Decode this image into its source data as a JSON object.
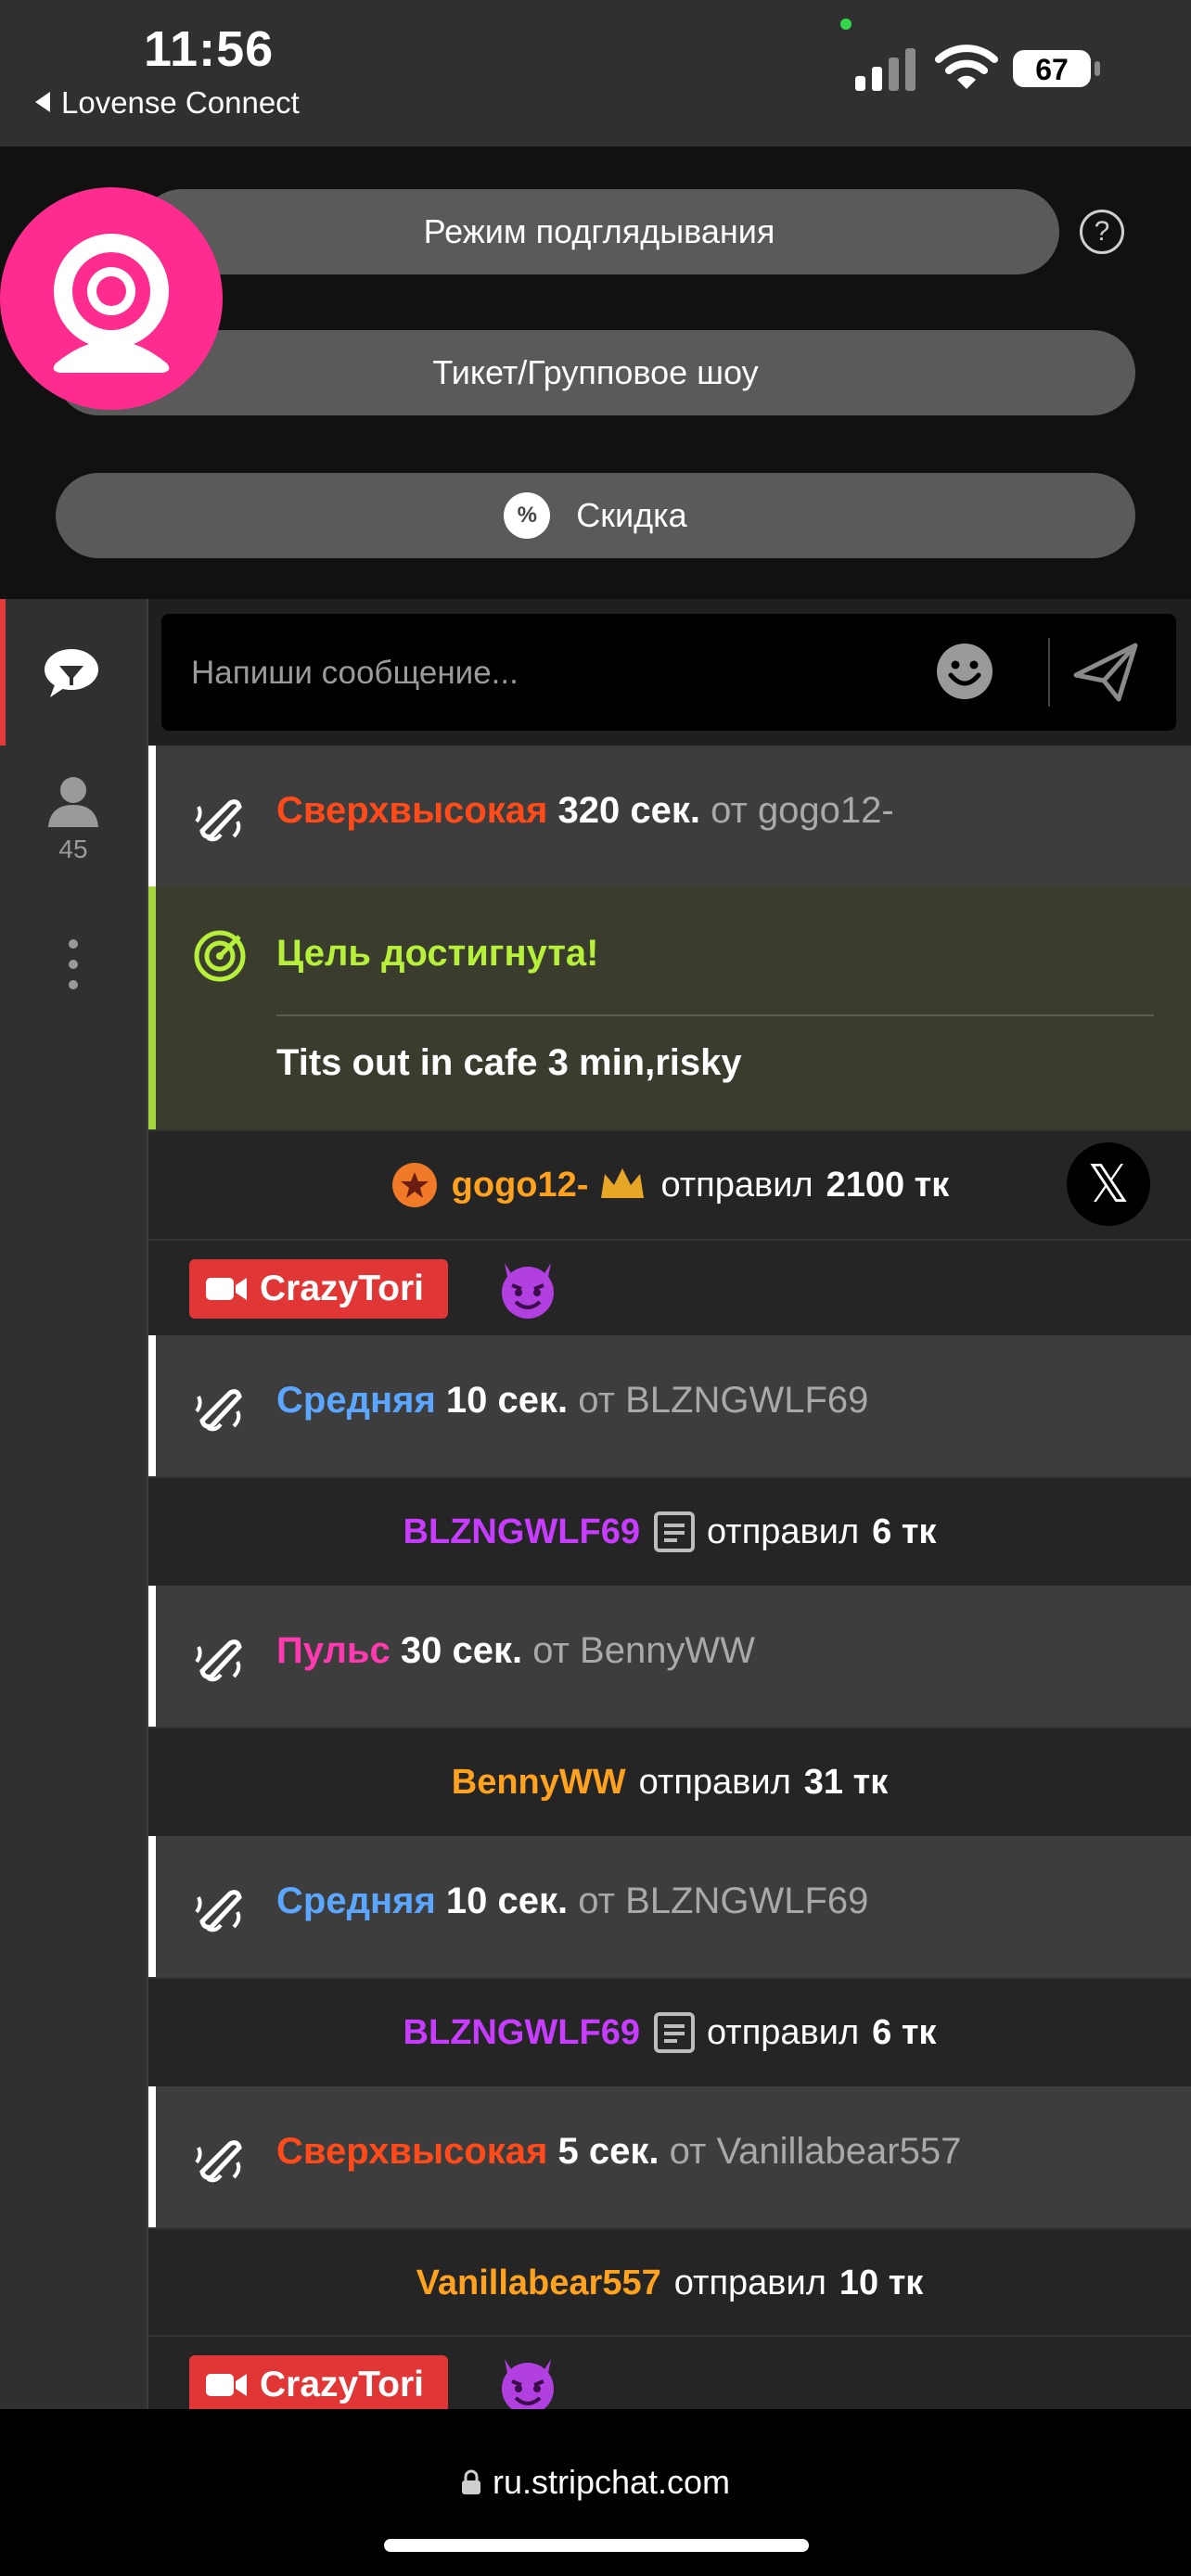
{
  "status_bar": {
    "time": "11:56",
    "back_app": "Lovense Connect",
    "battery": "67"
  },
  "controls": {
    "spy_mode": "Режим подглядывания",
    "ticket_show": "Тикет/Групповое шоу",
    "discount": "Скидка",
    "help_symbol": "?",
    "discount_symbol": "%"
  },
  "sidebar": {
    "users_count": "45"
  },
  "composer": {
    "placeholder": "Напиши сообщение..."
  },
  "chat": {
    "messages": [
      {
        "type": "vibe",
        "level": "Сверхвысокая",
        "duration": "320 сек.",
        "from_word": "от",
        "user": "gogo12-"
      },
      {
        "type": "goal",
        "title": "Цель достигнута!",
        "text": "Tits out in cafe 3 min,risky"
      },
      {
        "type": "tip",
        "user": "gogo12-",
        "action": "отправил",
        "amount": "2100 тк"
      },
      {
        "type": "model",
        "name": "CrazyTori",
        "emoji": "devil"
      },
      {
        "type": "vibe",
        "level": "Средняя",
        "duration": "10 сек.",
        "from_word": "от",
        "user": "BLZNGWLF69"
      },
      {
        "type": "tip",
        "user": "BLZNGWLF69",
        "action": "отправил",
        "amount": "6 тк"
      },
      {
        "type": "vibe",
        "level": "Пульс",
        "duration": "30 сек.",
        "from_word": "от",
        "user": "BennyWW"
      },
      {
        "type": "tip",
        "user": "BennyWW",
        "action": "отправил",
        "amount": "31 тк"
      },
      {
        "type": "vibe",
        "level": "Средняя",
        "duration": "10 сек.",
        "from_word": "от",
        "user": "BLZNGWLF69"
      },
      {
        "type": "tip",
        "user": "BLZNGWLF69",
        "action": "отправил",
        "amount": "6 тк"
      },
      {
        "type": "vibe",
        "level": "Сверхвысокая",
        "duration": "5 сек.",
        "from_word": "от",
        "user": "Vanillabear557"
      },
      {
        "type": "tip",
        "user": "Vanillabear557",
        "action": "отправил",
        "amount": "10 тк"
      },
      {
        "type": "model",
        "name": "CrazyTori",
        "emoji": "devil"
      }
    ]
  },
  "browser": {
    "url": "ru.stripchat.com"
  },
  "colors": {
    "level_ultra_high": "#ff4a1a",
    "level_medium": "#5ba6ff",
    "level_pulse": "#ff3ab0",
    "goal_green": "#b6f03a",
    "username_purple": "#c73cff",
    "username_orange": "#ffa21f",
    "model_badge_red": "#e03636",
    "cam_pink": "#ff2c8f"
  },
  "icons": [
    "webcam-icon",
    "help-icon",
    "discount-icon",
    "chat-icon",
    "user-icon",
    "more-icon",
    "emoji-icon",
    "send-icon",
    "vibration-icon",
    "goal-target-icon",
    "star-badge-icon",
    "crown-icon",
    "x-close-icon",
    "video-camera-icon",
    "devil-emoji-icon",
    "note-icon",
    "lock-icon"
  ]
}
